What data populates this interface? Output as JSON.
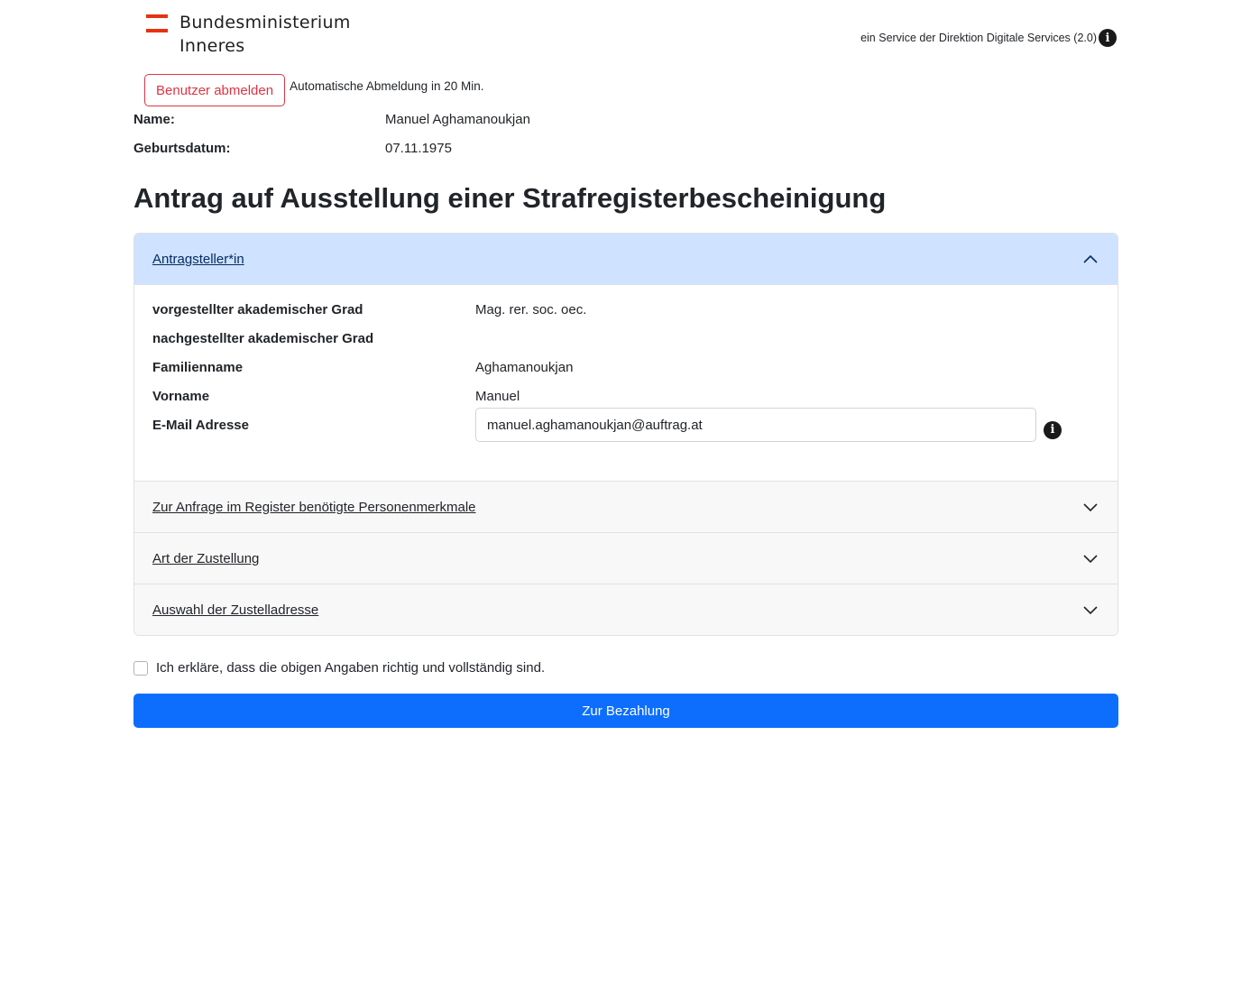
{
  "header": {
    "logo_line1": "Bundesministerium",
    "logo_line2": "Inneres",
    "service_text": "ein Service der Direktion Digitale Services (2.0)"
  },
  "session": {
    "logout_label": "Benutzer abmelden",
    "auto_logout_text": "Automatische Abmeldung in 20 Min."
  },
  "person": {
    "name_label": "Name:",
    "name_value": "Manuel Aghamanoukjan",
    "birth_label": "Geburtsdatum:",
    "birth_value": "07.11.1975"
  },
  "page_title": "Antrag auf Ausstellung einer Strafregisterbescheinigung",
  "accordion": {
    "sections": [
      {
        "title": "Antragsteller*in",
        "expanded": true
      },
      {
        "title": "Zur Anfrage im Register benötigte Personenmerkmale",
        "expanded": false
      },
      {
        "title": "Art der Zustellung",
        "expanded": false
      },
      {
        "title": "Auswahl der Zustelladresse",
        "expanded": false
      }
    ],
    "applicant": {
      "prefix_degree_label": "vorgestellter akademischer Grad",
      "prefix_degree_value": "Mag. rer. soc. oec.",
      "suffix_degree_label": "nachgestellter akademischer Grad",
      "suffix_degree_value": "",
      "family_name_label": "Familienname",
      "family_name_value": "Aghamanoukjan",
      "first_name_label": "Vorname",
      "first_name_value": "Manuel",
      "email_label": "E-Mail Adresse",
      "email_value": "manuel.aghamanoukjan@auftrag.at"
    }
  },
  "confirm_text": "Ich erkläre, dass die obigen Angaben richtig und vollständig sind.",
  "pay_button_label": "Zur Bezahlung",
  "colors": {
    "primary": "#0d6efd",
    "danger": "#dc3545",
    "accordion_open_bg": "#cfe2ff",
    "flag_red": "#e6320f"
  }
}
